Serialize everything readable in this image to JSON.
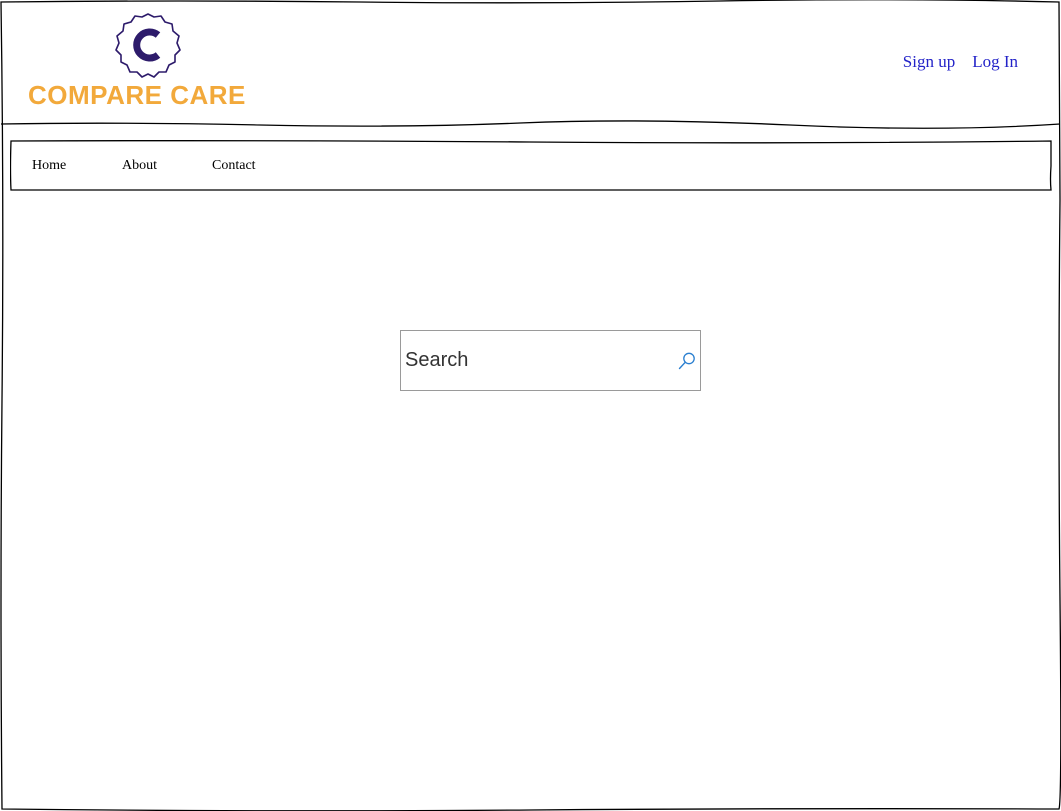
{
  "brand": {
    "name": "COMPARE CARE",
    "badge_letter": "C",
    "primary_color": "#f2a93b",
    "badge_color": "#2d1b6b"
  },
  "header": {
    "signup_label": "Sign up",
    "login_label": "Log In",
    "link_color": "#2323c8"
  },
  "nav": {
    "items": [
      {
        "label": "Home"
      },
      {
        "label": "About"
      },
      {
        "label": "Contact"
      }
    ]
  },
  "search": {
    "placeholder": "Search",
    "value": "",
    "icon": "search-icon"
  }
}
